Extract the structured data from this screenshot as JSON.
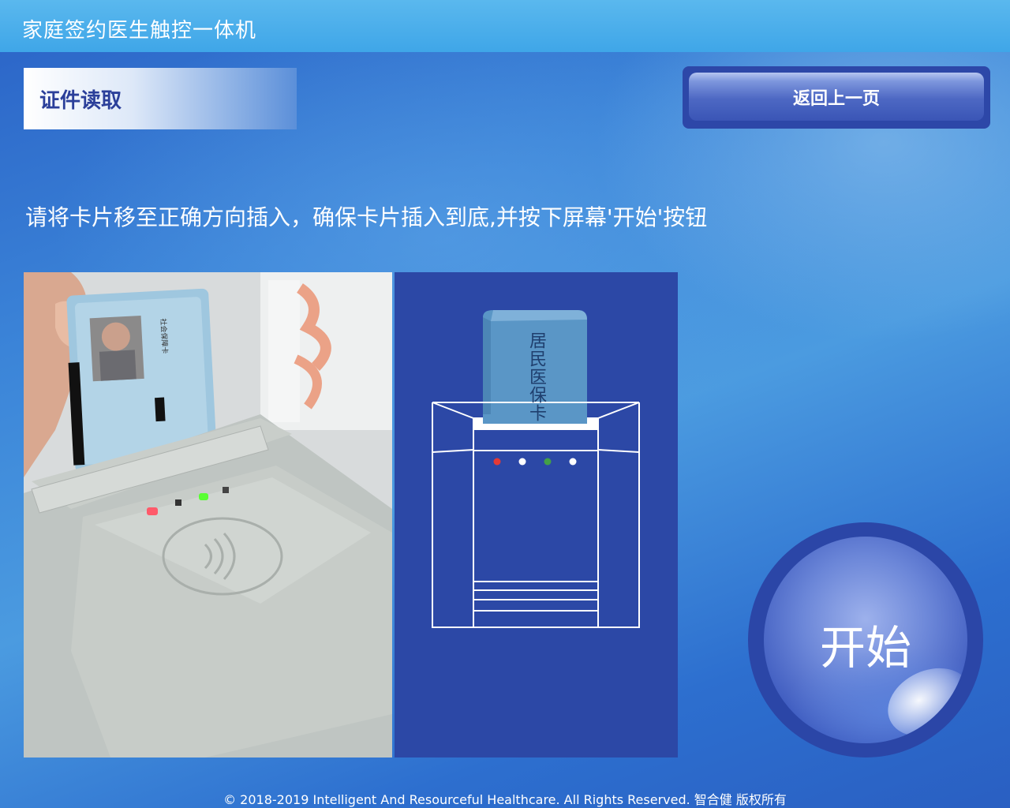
{
  "app": {
    "title": "家庭签约医生触控一体机"
  },
  "section": {
    "label": "证件读取"
  },
  "back_button": {
    "label": "返回上一页"
  },
  "instruction": "请将卡片移至正确方向插入，确保卡片插入到底,并按下屏幕'开始'按钮",
  "diagram": {
    "card_label": "居民医保卡"
  },
  "start_button": {
    "label": "开始"
  },
  "footer": {
    "copyright": "© 2018-2019 Intelligent And Resourceful Healthcare. All Rights Reserved. 智合健 版权所有"
  },
  "colors": {
    "panel_blue": "#2c48a6",
    "topbar": "#45aaea",
    "accent_dark": "#2b3f9a"
  }
}
